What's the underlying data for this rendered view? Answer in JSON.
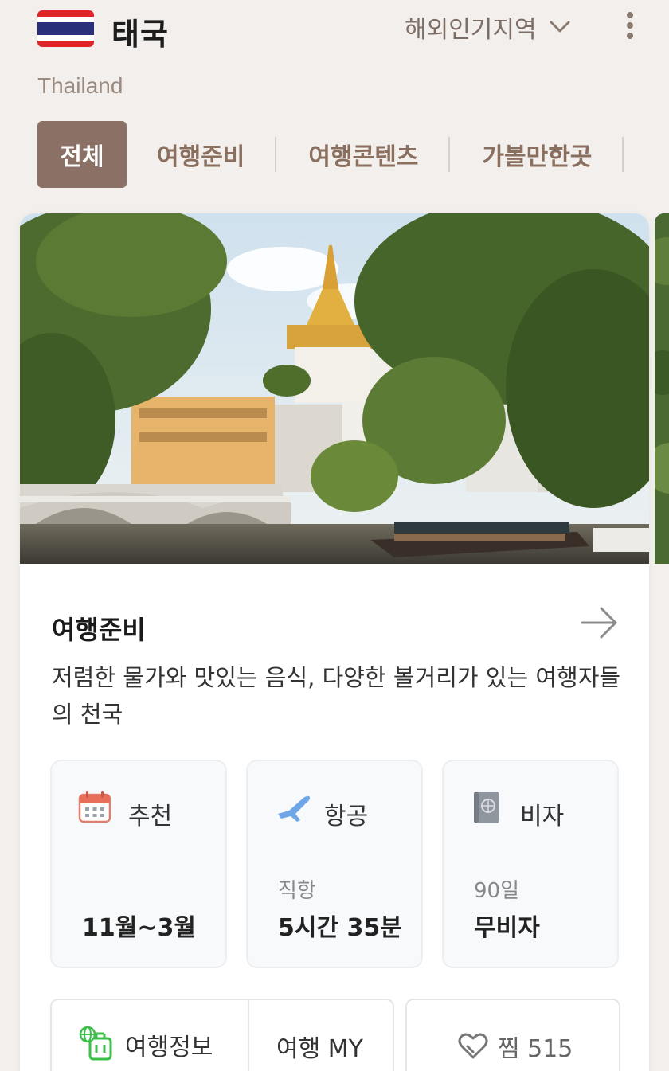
{
  "header": {
    "country": "태국",
    "country_en": "Thailand",
    "region_select": "해외인기지역",
    "flag_colors": [
      "#e0262b",
      "#ffffff",
      "#2a2f7a"
    ]
  },
  "tabs": [
    {
      "label": "전체",
      "active": true
    },
    {
      "label": "여행준비",
      "active": false
    },
    {
      "label": "여행콘텐츠",
      "active": false
    },
    {
      "label": "가볼만한곳",
      "active": false
    }
  ],
  "card": {
    "section_title": "여행준비",
    "description": "저렴한 물가와 맛있는 음식, 다양한 볼거리가 있는 여행자들의 천국",
    "info": [
      {
        "icon": "calendar-icon",
        "label": "추천",
        "sub": "",
        "value": "11월~3월"
      },
      {
        "icon": "airplane-icon",
        "label": "항공",
        "sub": "직항",
        "value": "5시간 35분"
      },
      {
        "icon": "passport-icon",
        "label": "비자",
        "sub": "90일",
        "value": "무비자"
      }
    ],
    "actions": {
      "travel_info": "여행정보",
      "travel_my": "여행 MY",
      "save": "찜 515"
    }
  },
  "colors": {
    "accent": "#8b7165",
    "tab_text": "#8a6f5f",
    "background": "#f2efec"
  }
}
